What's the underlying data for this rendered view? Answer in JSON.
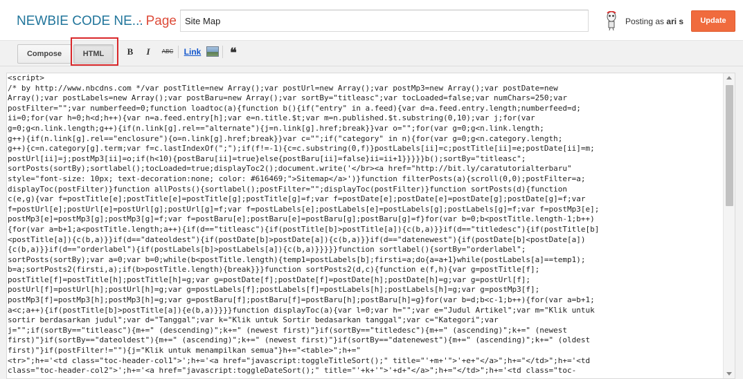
{
  "header": {
    "blog_title": "NEWBIE CODE NE...",
    "page_label": "· Page",
    "title_value": "Site Map",
    "posting_as_prefix": "Posting as",
    "posting_as_user": "ari s",
    "update_label": "Update"
  },
  "toolbar": {
    "compose_label": "Compose",
    "html_label": "HTML",
    "bold_glyph": "B",
    "italic_glyph": "I",
    "strike_glyph": "ABC",
    "link_label": "Link",
    "quote_glyph": "❝"
  },
  "editor": {
    "lines": [
      "<script>",
      "/* by http://www.nbcdns.com */var postTitle=new Array();var postUrl=new Array();var postMp3=new Array();var postDate=new",
      "Array();var postLabels=new Array();var postBaru=new Array();var sortBy=\"titleasc\";var tocLoaded=false;var numChars=250;var",
      "postFilter=\"\";var numberfeed=0;function loadtoc(a){function b(){if(\"entry\" in a.feed){var d=a.feed.entry.length;numberfeed=d;",
      "ii=0;for(var h=0;h<d;h++){var n=a.feed.entry[h];var e=n.title.$t;var m=n.published.$t.substring(0,10);var j;for(var",
      "g=0;g<n.link.length;g++){if(n.link[g].rel==\"alternate\"){j=n.link[g].href;break}}var o=\"\";for(var g=0;g<n.link.length;",
      "g++){if(n.link[g].rel==\"enclosure\"){o=n.link[g].href;break}}var c=\"\";if(\"category\" in n){for(var g=0;g<n.category.length;",
      "g++){c=n.category[g].term;var f=c.lastIndexOf(\";\");if(f!=-1){c=c.substring(0,f)}postLabels[ii]=c;postTitle[ii]=e;postDate[ii]=m;",
      "postUrl[ii]=j;postMp3[ii]=o;if(h<10){postBaru[ii]=true}else{postBaru[ii]=false}ii=ii+1}}}}}b();sortBy=\"titleasc\";",
      "sortPosts(sortBy);sortlabel();tocLoaded=true;displayToc2();document.write('</br><a href=\"http://bit.ly/caratutorialterbaru\"",
      "style=\"font-size: 10px; text-decoration:none; color: #616469;\">Sitemap</a>')}function filterPosts(a){scroll(0,0);postFilter=a;",
      "displayToc(postFilter)}function allPosts(){sortlabel();postFilter=\"\";displayToc(postFilter)}function sortPosts(d){function",
      "c(e,g){var f=postTitle[e];postTitle[e]=postTitle[g];postTitle[g]=f;var f=postDate[e];postDate[e]=postDate[g];postDate[g]=f;var",
      "f=postUrl[e];postUrl[e]=postUrl[g];postUrl[g]=f;var f=postLabels[e];postLabels[e]=postLabels[g];postLabels[g]=f;var f=postMp3[e];",
      "postMp3[e]=postMp3[g];postMp3[g]=f;var f=postBaru[e];postBaru[e]=postBaru[g];postBaru[g]=f}for(var b=0;b<postTitle.length-1;b++)",
      "{for(var a=b+1;a<postTitle.length;a++){if(d==\"titleasc\"){if(postTitle[b]>postTitle[a]){c(b,a)}}if(d==\"titledesc\"){if(postTitle[b]",
      "<postTitle[a]){c(b,a)}}if(d==\"dateoldest\"){if(postDate[b]>postDate[a]){c(b,a)}}if(d==\"datenewest\"){if(postDate[b]<postDate[a])",
      "{c(b,a)}}if(d==\"orderlabel\"){if(postLabels[b]>postLabels[a]){c(b,a)}}}}}function sortlabel(){sortBy=\"orderlabel\";",
      "sortPosts(sortBy);var a=0;var b=0;while(b<postTitle.length){temp1=postLabels[b];firsti=a;do{a=a+1}while(postLabels[a]==temp1);",
      "b=a;sortPosts2(firsti,a);if(b>postTitle.length){break}}}function sortPosts2(d,c){function e(f,h){var g=postTitle[f];",
      "postTitle[f]=postTitle[h];postTitle[h]=g;var g=postDate[f];postDate[f]=postDate[h];postDate[h]=g;var g=postUrl[f];",
      "postUrl[f]=postUrl[h];postUrl[h]=g;var g=postLabels[f];postLabels[f]=postLabels[h];postLabels[h]=g;var g=postMp3[f];",
      "postMp3[f]=postMp3[h];postMp3[h]=g;var g=postBaru[f];postBaru[f]=postBaru[h];postBaru[h]=g}for(var b=d;b<c-1;b++){for(var a=b+1;",
      "a<c;a++){if(postTitle[b]>postTitle[a]){e(b,a)}}}}function displayToc(a){var l=0;var h=\"\";var e=\"Judul Artikel\";var m=\"Klik untuk",
      "sortir berdasarkan judul\";var d=\"Tanggal\";var k=\"Klik untuk Sortir bedasarkan tanggal\";var c=\"Kategori\";var",
      "j=\"\";if(sortBy==\"titleasc\"){m+=\" (descending)\";k+=\" (newest first)\"}if(sortBy==\"titledesc\"){m+=\" (ascending)\";k+=\" (newest",
      "first)\"}if(sortBy==\"dateoldest\"){m+=\" (ascending)\";k+=\" (newest first)\"}if(sortBy==\"datenewest\"){m+=\" (ascending)\";k+=\" (oldest",
      "first)\"}if(postFilter!=\"\"){j=\"Klik untuk menampilkan semua\"}h+=\"<table>\";h+=\"",
      "<tr>\";h+='<td class=\"toc-header-col1\">';h+='<a href=\"javascript:toggleTitleSort();\" title=\"'+m+'\">'+e+\"</a>\";h+=\"</td>\";h+='<td",
      "class=\"toc-header-col2\">';h+='<a href=\"javascript:toggleDateSort();\" title=\"'+k+'\">'+d+\"</a>\";h+=\"</td>\";h+='<td class=\"toc-"
    ]
  }
}
